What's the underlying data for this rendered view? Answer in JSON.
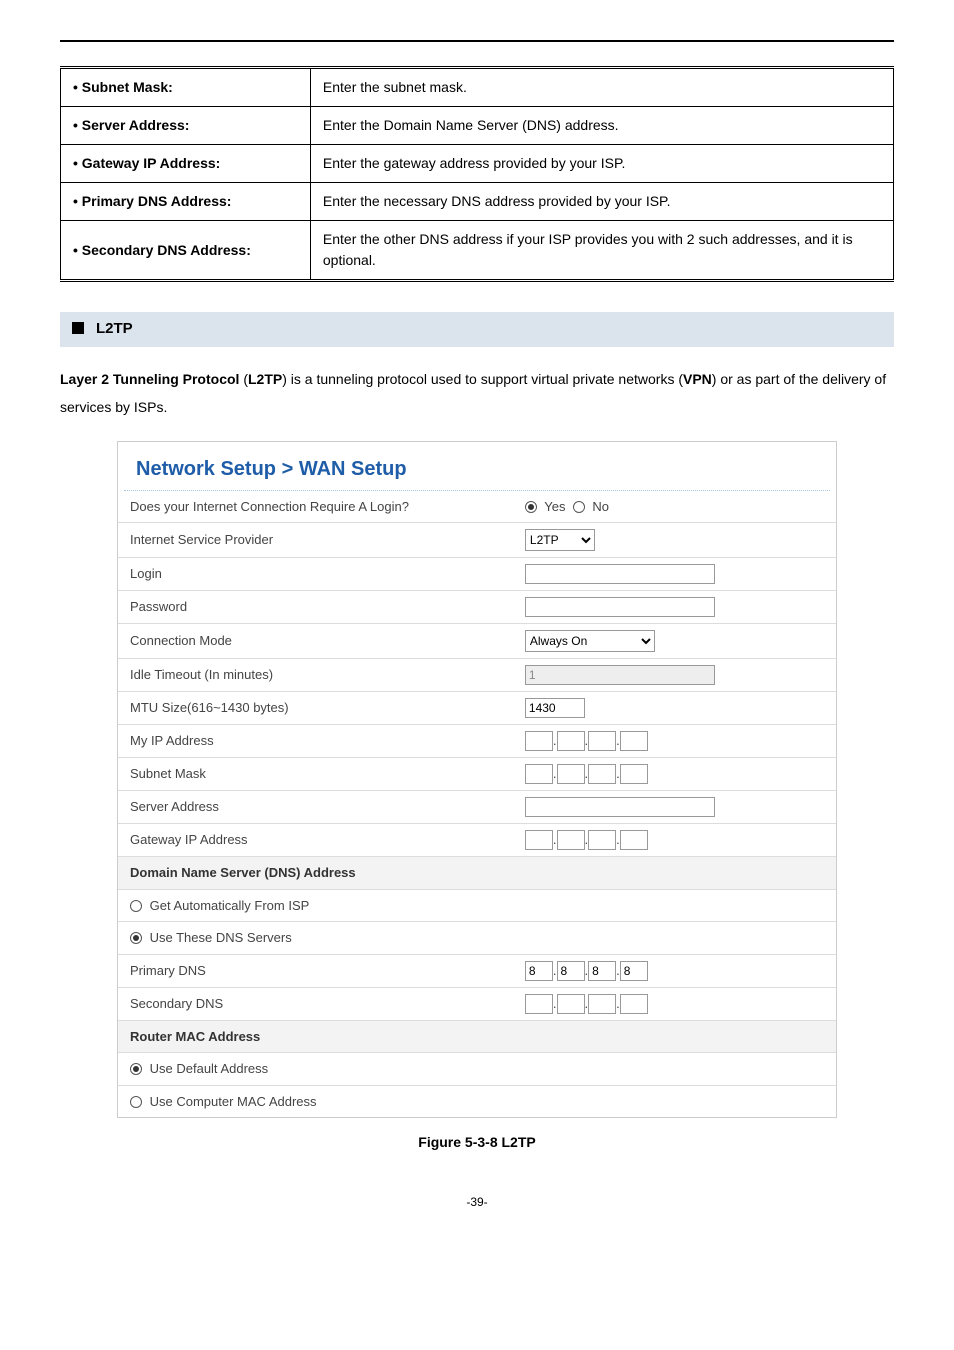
{
  "desc_table": [
    {
      "label": "Subnet Mask:",
      "desc": "Enter the subnet mask."
    },
    {
      "label": "Server Address:",
      "desc": "Enter the Domain Name Server (DNS) address."
    },
    {
      "label": "Gateway IP Address:",
      "desc": "Enter the gateway address provided by your ISP."
    },
    {
      "label": "Primary DNS Address:",
      "desc": "Enter the necessary DNS address provided by your ISP."
    },
    {
      "label": "Secondary DNS Address:",
      "desc": "Enter the other DNS address if your ISP provides you with 2 such addresses, and it is optional."
    }
  ],
  "section_heading": "L2TP",
  "body_para": {
    "b1": "Layer 2 Tunneling Protocol",
    "t1": " (",
    "b2": "L2TP",
    "t2": ") is a tunneling protocol used to support virtual private networks (",
    "b3": "VPN",
    "t3": ") or as part of the delivery of services by ISPs."
  },
  "wan": {
    "title": "Network Setup > WAN Setup",
    "row_require": "Does your Internet Connection Require A Login?",
    "opt_yes": "Yes",
    "opt_no": "No",
    "row_isp": "Internet Service Provider",
    "isp_val": "L2TP",
    "row_login": "Login",
    "row_password": "Password",
    "row_connmode": "Connection Mode",
    "connmode_val": "Always On",
    "row_idle": "Idle Timeout (In minutes)",
    "idle_val": "1",
    "row_mtu": "MTU Size(616~1430 bytes)",
    "mtu_val": "1430",
    "row_myip": "My IP Address",
    "row_subnet": "Subnet Mask",
    "row_server": "Server Address",
    "row_gw": "Gateway IP Address",
    "sec_dns": "Domain Name Server (DNS) Address",
    "opt_autoisp": "Get Automatically From ISP",
    "opt_usedns": "Use These DNS Servers",
    "row_pdns": "Primary DNS",
    "pdns": [
      "8",
      "8",
      "8",
      "8"
    ],
    "row_sdns": "Secondary DNS",
    "sec_mac": "Router MAC Address",
    "opt_defmac": "Use Default Address",
    "opt_compmac": "Use Computer MAC Address"
  },
  "caption": "Figure 5-3-8 L2TP",
  "pagenum": "-39-"
}
